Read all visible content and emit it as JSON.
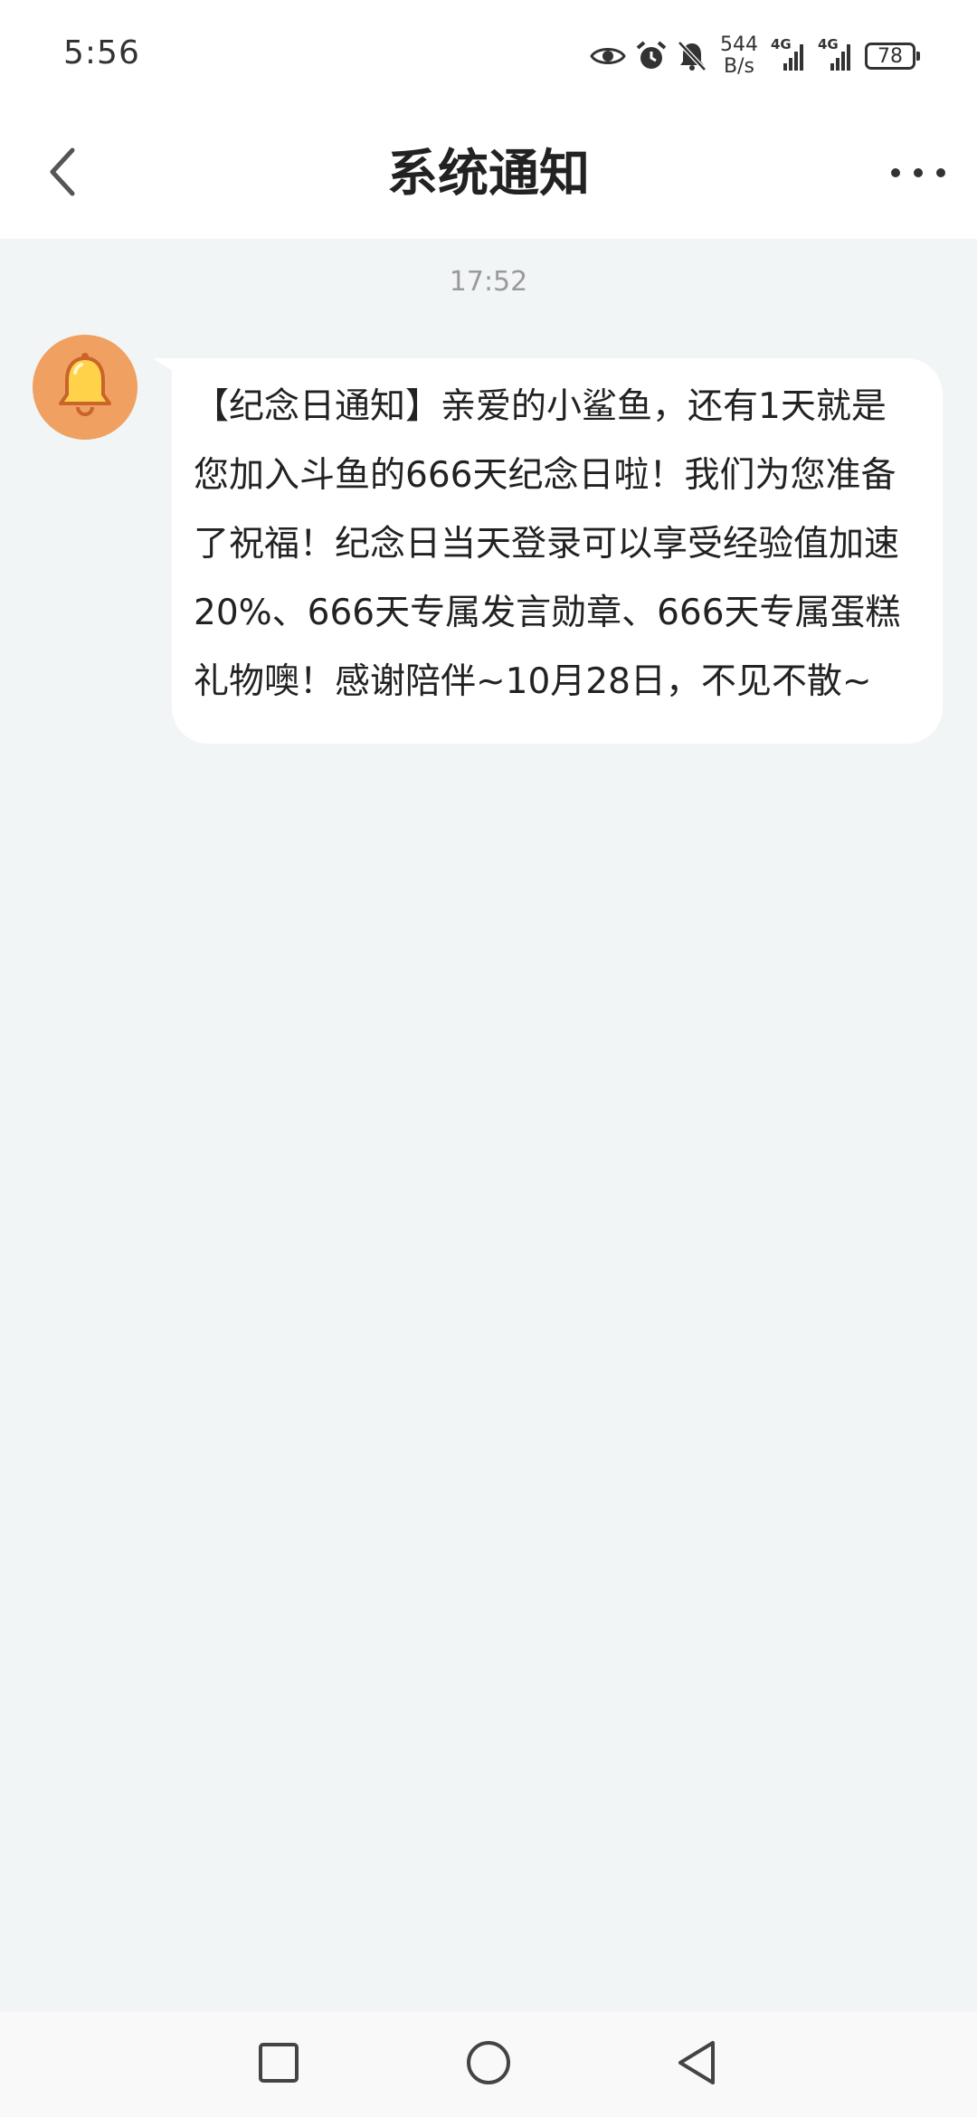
{
  "status_bar": {
    "time": "5:56",
    "net_speed_value": "544",
    "net_speed_unit": "B/s",
    "signal1_label": "4G",
    "signal2_label": "4G",
    "battery": "78",
    "icons": [
      "eye-icon",
      "alarm-icon",
      "bell-off-icon",
      "signal-icon",
      "signal-icon",
      "battery-icon"
    ]
  },
  "header": {
    "title": "系统通知",
    "back_icon": "chevron-left-icon",
    "more_icon": "more-horizontal-icon"
  },
  "chat": {
    "timestamp": "17:52",
    "avatar_icon": "bell-icon",
    "avatar_color": "#f0a060",
    "message": "【纪念日通知】亲爱的小鲨鱼，还有1天就是您加入斗鱼的666天纪念日啦！我们为您准备了祝福！纪念日当天登录可以享受经验值加速20%、666天专属发言勋章、666天专属蛋糕礼物噢！感谢陪伴~10月28日，不见不散~"
  },
  "bottom_nav": {
    "items": [
      "square-icon",
      "circle-icon",
      "triangle-back-icon"
    ]
  }
}
